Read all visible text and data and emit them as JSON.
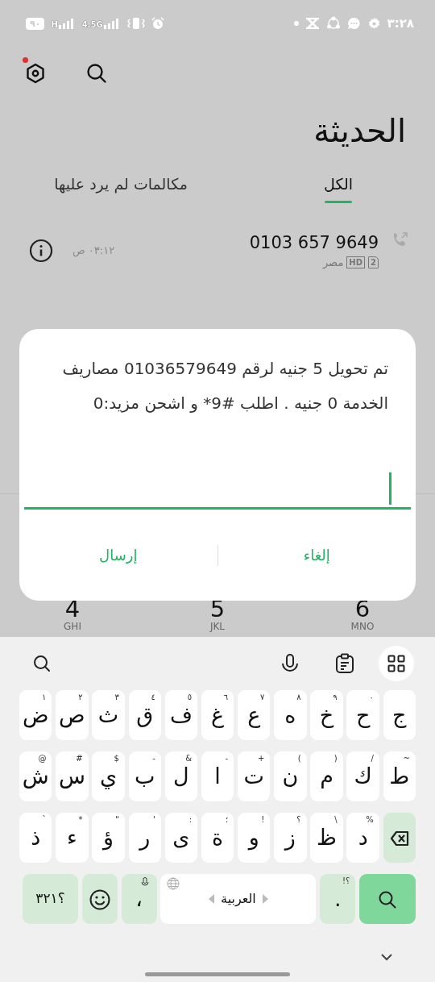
{
  "status_bar": {
    "battery": "٩٠",
    "network_1": "H",
    "network_2": "4.5G",
    "time": "٣:٢٨"
  },
  "header": {
    "notification_dot": true
  },
  "title": "الحديثة",
  "tabs": [
    {
      "label": "الكل",
      "selected": true
    },
    {
      "label": "مكالمات لم يرد عليها",
      "selected": false
    }
  ],
  "calls": [
    {
      "number": "0103 657 9649",
      "sim": "2",
      "quality": "HD",
      "location": "مصر",
      "time": "٠٣:١٢ ص"
    }
  ],
  "dialpad": [
    {
      "digit": "6",
      "letters": "MNO"
    },
    {
      "digit": "5",
      "letters": "JKL"
    },
    {
      "digit": "4",
      "letters": "GHI"
    }
  ],
  "dialog": {
    "message": "تم تحويل 5 جنيه لرقم 01036579649 مصاريف الخدمة 0 جنيه . اطلب #9* و اشحن مزيد:0",
    "buttons": [
      {
        "label": "إلغاء"
      },
      {
        "label": "إرسال"
      }
    ]
  },
  "keyboard": {
    "rows": [
      [
        {
          "kind": "letter",
          "label": "ج"
        },
        {
          "kind": "letter",
          "label": "ح",
          "hint": "٠"
        },
        {
          "kind": "letter",
          "label": "خ",
          "hint": "٩"
        },
        {
          "kind": "letter",
          "label": "ه",
          "hint": "٨"
        },
        {
          "kind": "letter",
          "label": "ع",
          "hint": "٧"
        },
        {
          "kind": "letter",
          "label": "غ",
          "hint": "٦"
        },
        {
          "kind": "letter",
          "label": "ف",
          "hint": "٥"
        },
        {
          "kind": "letter",
          "label": "ق",
          "hint": "٤"
        },
        {
          "kind": "letter",
          "label": "ث",
          "hint": "٣"
        },
        {
          "kind": "letter",
          "label": "ص",
          "hint": "٢"
        },
        {
          "kind": "letter",
          "label": "ض",
          "hint": "١"
        }
      ],
      [
        {
          "kind": "letter",
          "label": "ط",
          "hint": "~"
        },
        {
          "kind": "letter",
          "label": "ك",
          "hint": "/"
        },
        {
          "kind": "letter",
          "label": "م",
          "hint": ")"
        },
        {
          "kind": "letter",
          "label": "ن",
          "hint": "("
        },
        {
          "kind": "letter",
          "label": "ت",
          "hint": "+"
        },
        {
          "kind": "letter",
          "label": "ا",
          "hint": "-"
        },
        {
          "kind": "letter",
          "label": "ل",
          "hint": "&"
        },
        {
          "kind": "letter",
          "label": "ب",
          "hint": "-"
        },
        {
          "kind": "letter",
          "label": "ي",
          "hint": "$"
        },
        {
          "kind": "letter",
          "label": "س",
          "hint": "#"
        },
        {
          "kind": "letter",
          "label": "ش",
          "hint": "@"
        }
      ],
      [
        {
          "kind": "backspace"
        },
        {
          "kind": "letter",
          "label": "د",
          "hint": "%"
        },
        {
          "kind": "letter",
          "label": "ظ",
          "hint": "\\"
        },
        {
          "kind": "letter",
          "label": "ز",
          "hint": "؟"
        },
        {
          "kind": "letter",
          "label": "و",
          "hint": "!"
        },
        {
          "kind": "letter",
          "label": "ة",
          "hint": "؛"
        },
        {
          "kind": "letter",
          "label": "ى",
          "hint": ":"
        },
        {
          "kind": "letter",
          "label": "ر",
          "hint": "'"
        },
        {
          "kind": "letter",
          "label": "ؤ",
          "hint": "\""
        },
        {
          "kind": "letter",
          "label": "ء",
          "hint": "*"
        },
        {
          "kind": "letter",
          "label": "ذ",
          "hint": "`"
        }
      ]
    ],
    "bottom_row": [
      {
        "kind": "search"
      },
      {
        "kind": "period",
        "label": ".",
        "hint": "!؟"
      },
      {
        "kind": "space",
        "label": "العربية"
      },
      {
        "kind": "comma",
        "label": "،"
      },
      {
        "kind": "emoji"
      },
      {
        "kind": "symbols",
        "label": "؟٣٢١"
      }
    ]
  }
}
